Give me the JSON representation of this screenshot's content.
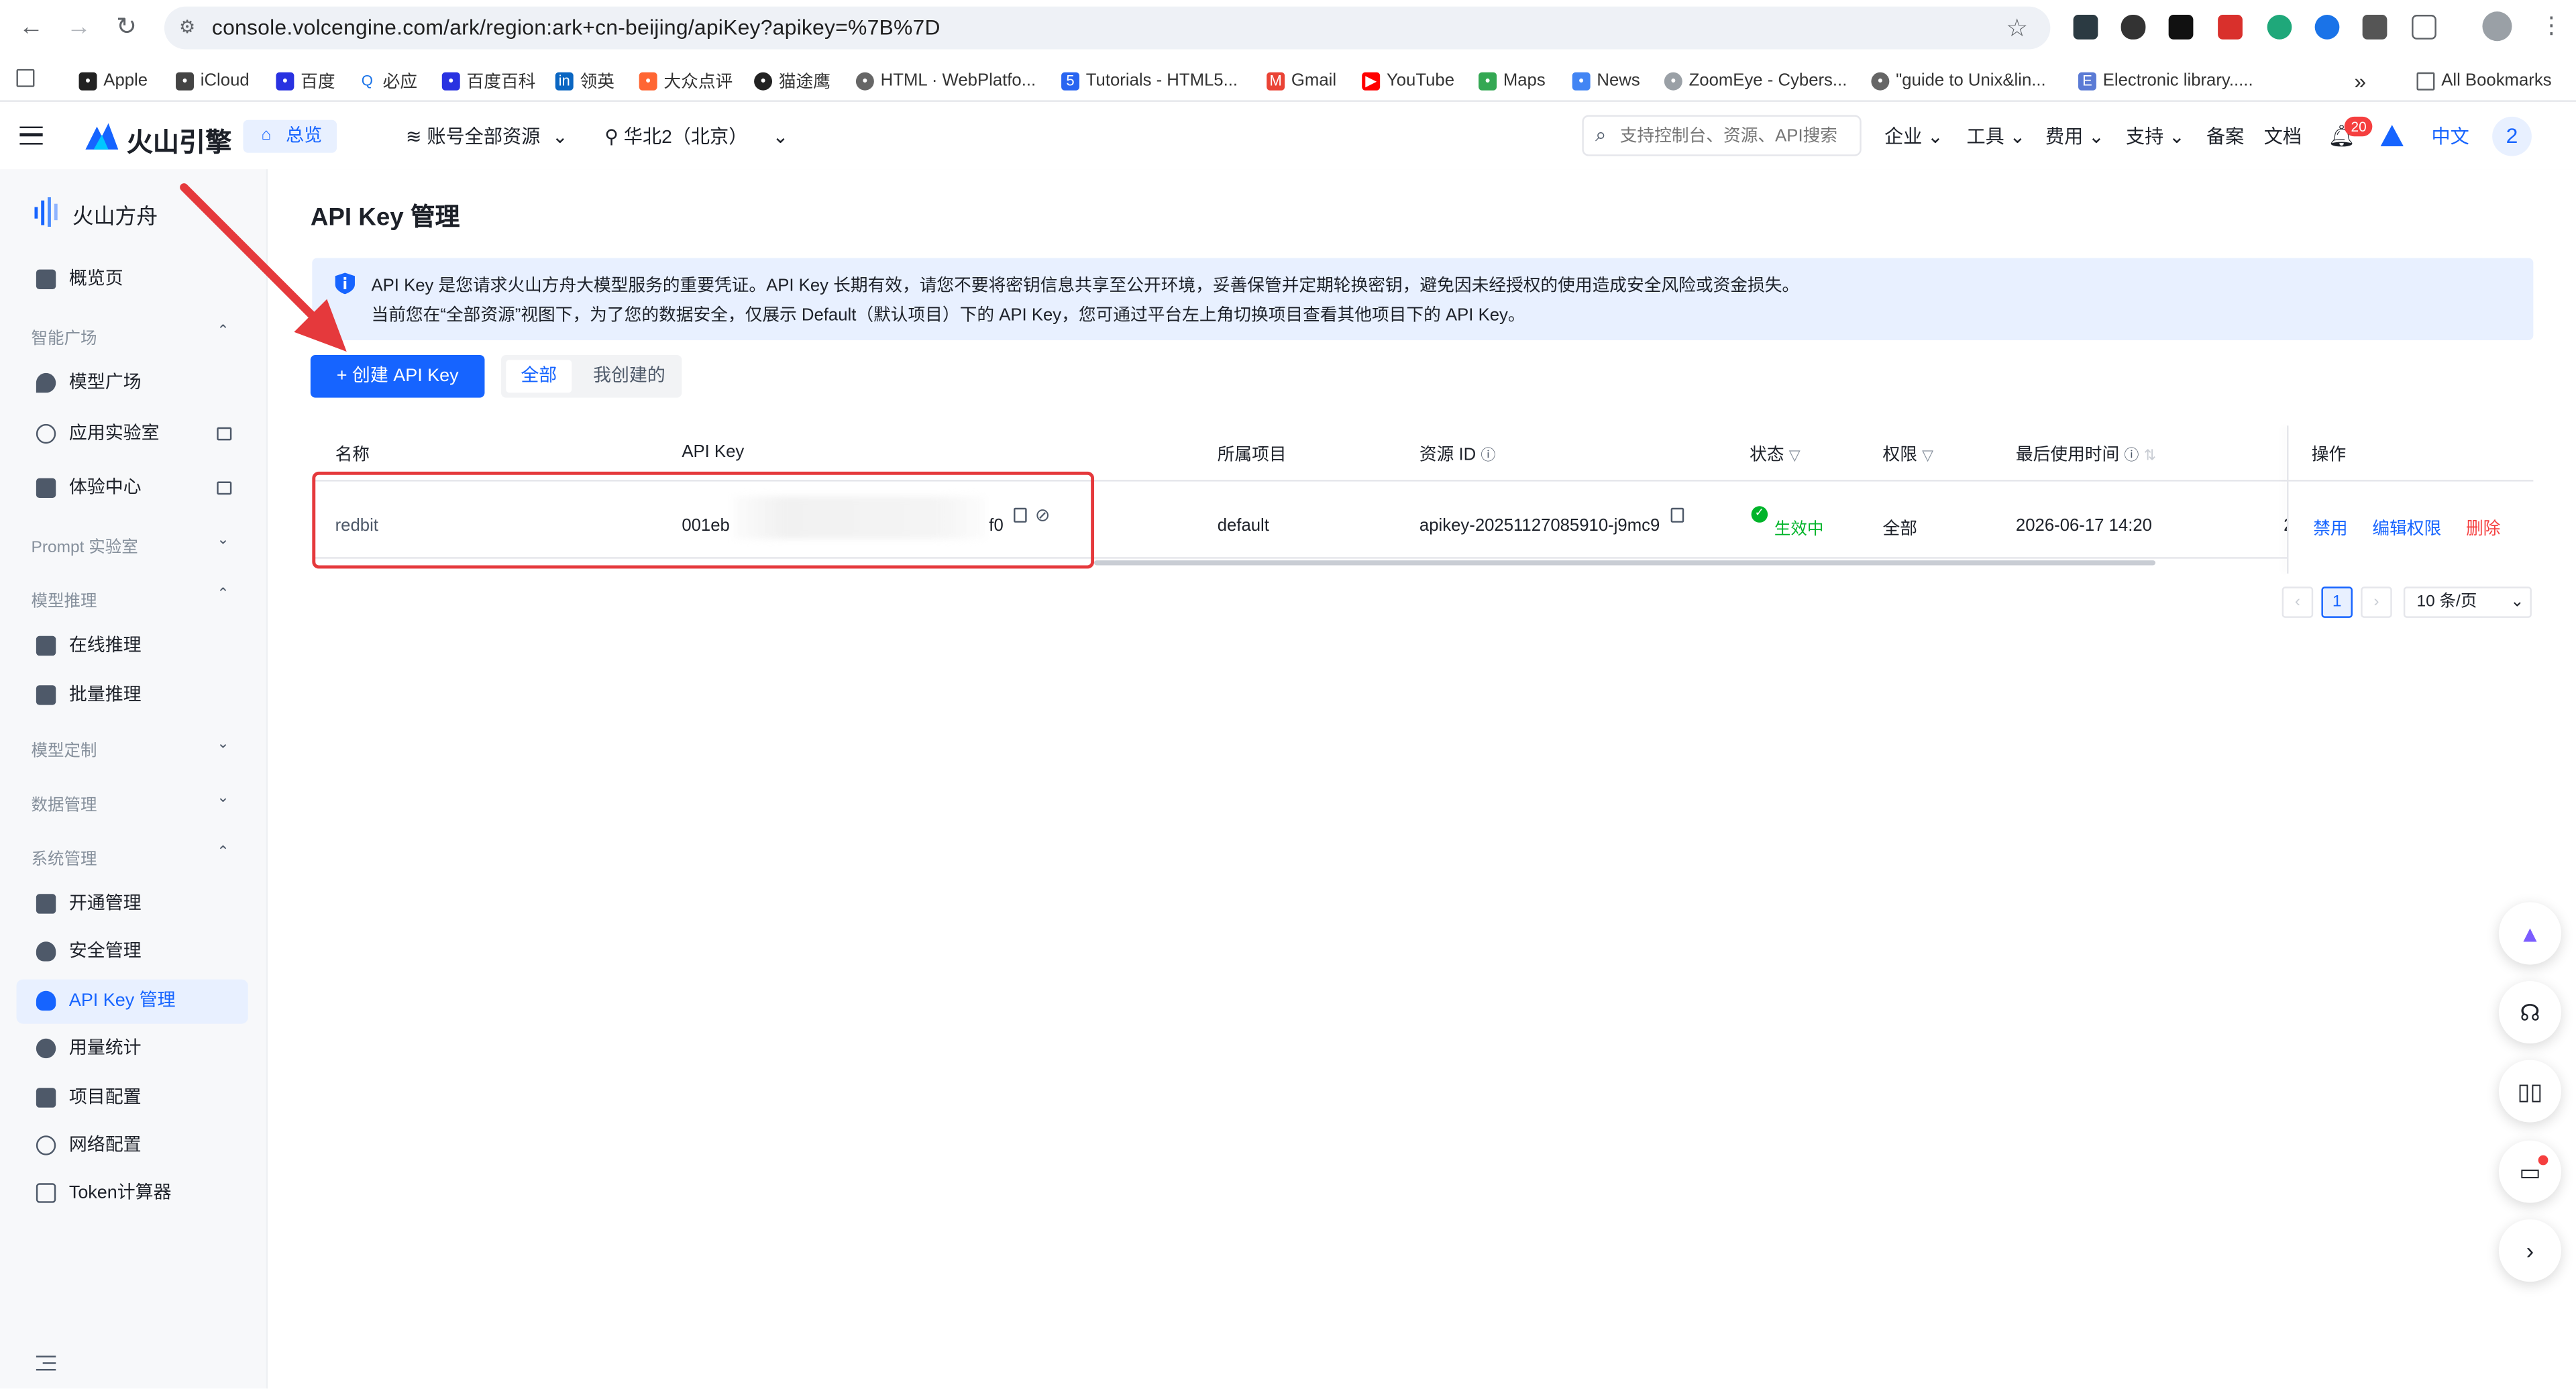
{
  "browser": {
    "url": "console.volcengine.com/ark/region:ark+cn-beijing/apiKey?apikey=%7B%7D",
    "bookmarks": [
      "Apple",
      "iCloud",
      "百度",
      "必应",
      "百度百科",
      "领英",
      "大众点评",
      "猫途鹰",
      "HTML · WebPlatfo...",
      "Tutorials - HTML5...",
      "Gmail",
      "YouTube",
      "Maps",
      "News",
      "ZoomEye - Cybers...",
      "\"guide to Unix&lin...",
      "Electronic library....."
    ],
    "all_bookmarks": "All Bookmarks",
    "overflow": "»"
  },
  "topnav": {
    "brand": "火山引擎",
    "overview_tab": "总览",
    "account_scope": "账号全部资源",
    "region": "华北2（北京）",
    "search_placeholder": "支持控制台、资源、API搜索",
    "menus": [
      "企业",
      "工具",
      "费用",
      "支持"
    ],
    "links": [
      "备案",
      "文档"
    ],
    "notification_count": "20",
    "language": "中文",
    "avatar": "2"
  },
  "sidebar": {
    "product": "火山方舟",
    "overview": "概览页",
    "groups": {
      "smart_plaza": "智能广场",
      "prompt_lab": "Prompt 实验室",
      "model_inference": "模型推理",
      "model_custom": "模型定制",
      "data_mgmt": "数据管理",
      "system_mgmt": "系统管理"
    },
    "items": {
      "model_plaza": "模型广场",
      "app_lab": "应用实验室",
      "experience": "体验中心",
      "online_infer": "在线推理",
      "batch_infer": "批量推理",
      "activation": "开通管理",
      "security": "安全管理",
      "apikey": "API Key 管理",
      "usage": "用量统计",
      "project": "项目配置",
      "network": "网络配置",
      "token_calc": "Token计算器"
    }
  },
  "page": {
    "title": "API Key 管理",
    "notice_line1": "API Key 是您请求火山方舟大模型服务的重要凭证。API Key 长期有效，请您不要将密钥信息共享至公开环境，妥善保管并定期轮换密钥，避免因未经授权的使用造成安全风险或资金损失。",
    "notice_line2": "当前您在“全部资源”视图下，为了您的数据安全，仅展示 Default（默认项目）下的 API Key，您可通过平台左上角切换项目查看其他项目下的 API Key。",
    "create_button": "+ 创建 API Key",
    "filter_all": "全部",
    "filter_mine": "我创建的"
  },
  "table": {
    "columns": [
      "名称",
      "API Key",
      "所属项目",
      "资源 ID",
      "状态",
      "权限",
      "最后使用时间",
      "操作"
    ],
    "row": {
      "name": "redbit",
      "apikey_prefix": "001eb",
      "apikey_suffix": "f0",
      "project": "default",
      "resource_id": "apikey-20251127085910-j9mc9",
      "status": "生效中",
      "permission": "全部",
      "last_used": "2026-06-17 14:20",
      "truncated": "2",
      "actions": [
        "禁用",
        "编辑权限",
        "删除"
      ]
    }
  },
  "pagination": {
    "prev": "‹",
    "current": "1",
    "next": "›",
    "page_size": "10 条/页"
  },
  "colors": {
    "primary": "#1664ff",
    "danger": "#f53f3f",
    "success": "#00b42a",
    "annotation": "#e5393c"
  }
}
